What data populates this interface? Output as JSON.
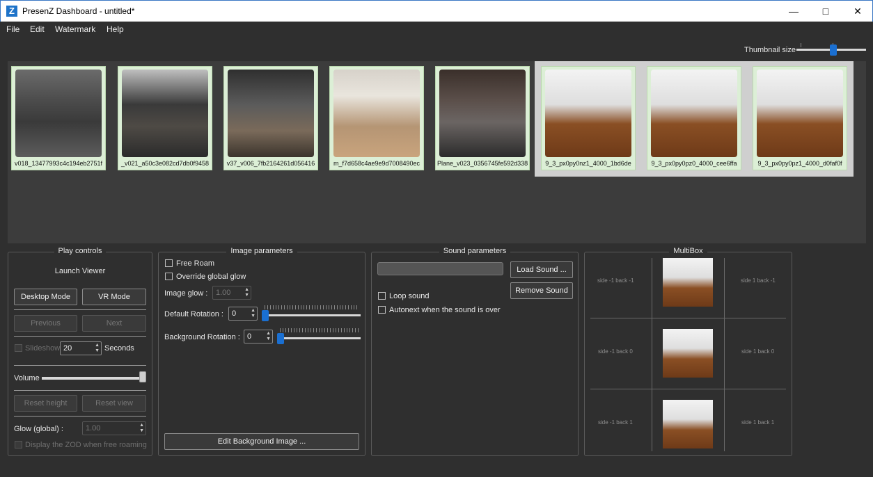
{
  "window": {
    "title": "PresenZ Dashboard - untitled*",
    "app_icon_letter": "Z"
  },
  "menu": [
    "File",
    "Edit",
    "Watermark",
    "Help"
  ],
  "thumbnail_size": {
    "label": "Thumbnail size",
    "value": 0.53
  },
  "gallery": {
    "thumbnails": [
      {
        "caption": "v018_13477993c4c194eb2751f",
        "image": "room-a",
        "selected": false
      },
      {
        "caption": "_v021_a50c3e082cd7db0f9458",
        "image": "room-b",
        "selected": false
      },
      {
        "caption": "v37_v006_7fb2164261d056416",
        "image": "room-c",
        "selected": false
      },
      {
        "caption": "m_f7d658c4ae9e9d7008490ec",
        "image": "room-d",
        "selected": false
      },
      {
        "caption": "Plane_v023_0356745fe592d338",
        "image": "room-e",
        "selected": false
      },
      {
        "caption": "9_3_px0py0nz1_4000_1bd6de",
        "image": "room-f",
        "selected": true
      },
      {
        "caption": "9_3_px0py0pz0_4000_cee6ffa",
        "image": "room-f",
        "selected": true
      },
      {
        "caption": "9_3_px0py0pz1_4000_d0faf0f",
        "image": "room-f",
        "selected": true
      }
    ]
  },
  "play_controls": {
    "title": "Play controls",
    "launch_viewer": "Launch Viewer",
    "desktop_mode": "Desktop Mode",
    "vr_mode": "VR Mode",
    "previous": "Previous",
    "next": "Next",
    "slideshow": "Slideshow",
    "slideshow_seconds_value": "20",
    "seconds": "Seconds",
    "volume": "Volume",
    "volume_value": 1.0,
    "reset_height": "Reset height",
    "reset_view": "Reset view",
    "glow_global": "Glow (global) :",
    "glow_global_value": "1.00",
    "display_zod": "Display the ZOD when free roaming"
  },
  "image_parameters": {
    "title": "Image parameters",
    "free_roam": "Free Roam",
    "override_global_glow": "Override global glow",
    "image_glow": "Image glow :",
    "image_glow_value": "1.00",
    "default_rotation": "Default Rotation :",
    "default_rotation_value": "0",
    "background_rotation": "Background Rotation :",
    "background_rotation_value": "0",
    "edit_background": "Edit Background Image ..."
  },
  "sound_parameters": {
    "title": "Sound parameters",
    "load_sound": "Load Sound ...",
    "remove_sound": "Remove Sound",
    "loop_sound": "Loop sound",
    "autonext": "Autonext when the sound is over"
  },
  "multibox": {
    "title": "MultiBox",
    "labels": [
      "side -1 back -1",
      "side 1 back -1",
      "side -1 back 0",
      "side 1 back 0",
      "side -1 back 1",
      "side 1 back 1"
    ]
  }
}
